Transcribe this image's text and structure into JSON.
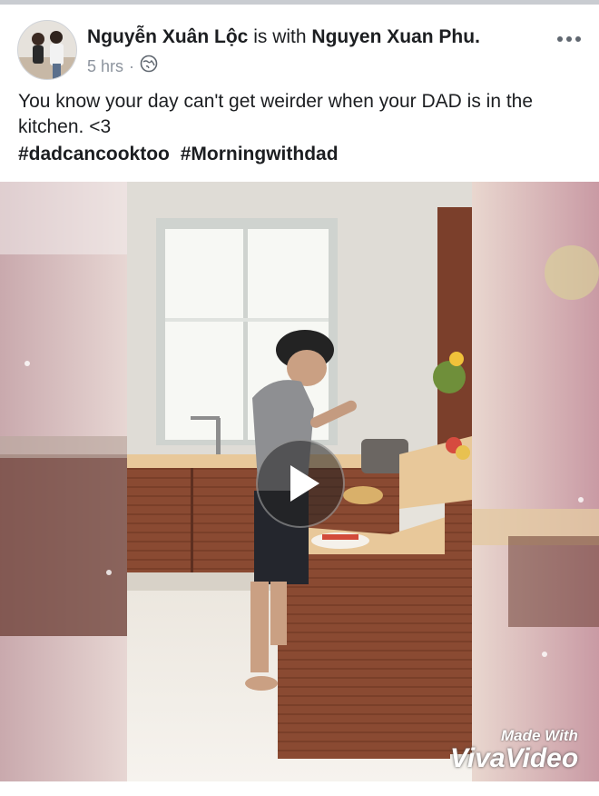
{
  "post": {
    "author": "Nguyễn Xuân Lộc",
    "with_text": "is with",
    "tagged": "Nguyen Xuan Phu.",
    "time": "5 hrs",
    "separator": "·",
    "privacy_icon": "globe-icon",
    "message": "You know your day can't get weirder when your DAD is in the kitchen. <3",
    "hashtags": [
      "#dadcancooktoo",
      "#Morningwithdad"
    ]
  },
  "video": {
    "watermark_line1": "Made With",
    "watermark_line2": "VivaVideo",
    "play_icon": "play-icon"
  },
  "colors": {
    "text": "#1c1e21",
    "meta": "#8d949e",
    "cabinet": "#8a4a32",
    "counter": "#e8c89a"
  }
}
